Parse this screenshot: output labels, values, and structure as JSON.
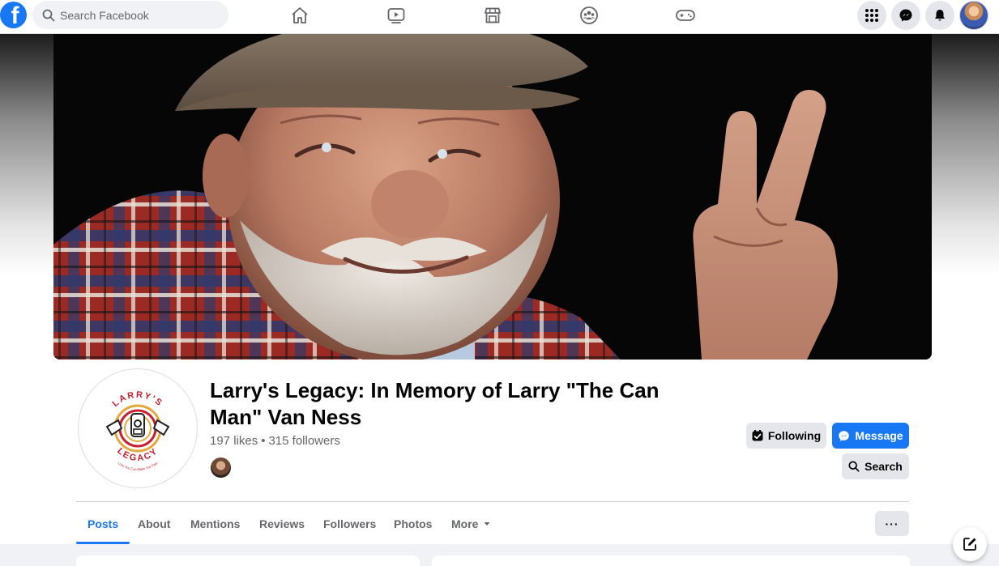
{
  "topbar": {
    "logo_letter": "f",
    "search_placeholder": "Search Facebook",
    "nav_icons": [
      "home-icon",
      "watch-icon",
      "marketplace-icon",
      "groups-icon",
      "gaming-icon"
    ],
    "right_icons": [
      "menu-grid-icon",
      "messenger-icon",
      "notifications-icon",
      "account-avatar"
    ]
  },
  "page": {
    "title": "Larry's Legacy: In Memory of Larry \"The Can Man\" Van Ness",
    "likes": "197 likes",
    "separator": "•",
    "followers": "315 followers",
    "logo": {
      "top_text": "LARRY'S",
      "bottom_text": "LEGACY",
      "tagline": "Love You Can Make The Past"
    }
  },
  "actions": {
    "following_label": "Following",
    "message_label": "Message",
    "search_label": "Search"
  },
  "tabs": [
    {
      "label": "Posts",
      "active": true
    },
    {
      "label": "About",
      "active": false
    },
    {
      "label": "Mentions",
      "active": false
    },
    {
      "label": "Reviews",
      "active": false
    },
    {
      "label": "Followers",
      "active": false
    },
    {
      "label": "Photos",
      "active": false
    },
    {
      "label": "More",
      "active": false
    }
  ],
  "more_dots": "···",
  "colors": {
    "brand": "#1877f2",
    "secondary_button": "#e4e6eb",
    "text_secondary": "#65676b",
    "logo_red": "#c8202f",
    "logo_gold": "#e2a93b"
  }
}
